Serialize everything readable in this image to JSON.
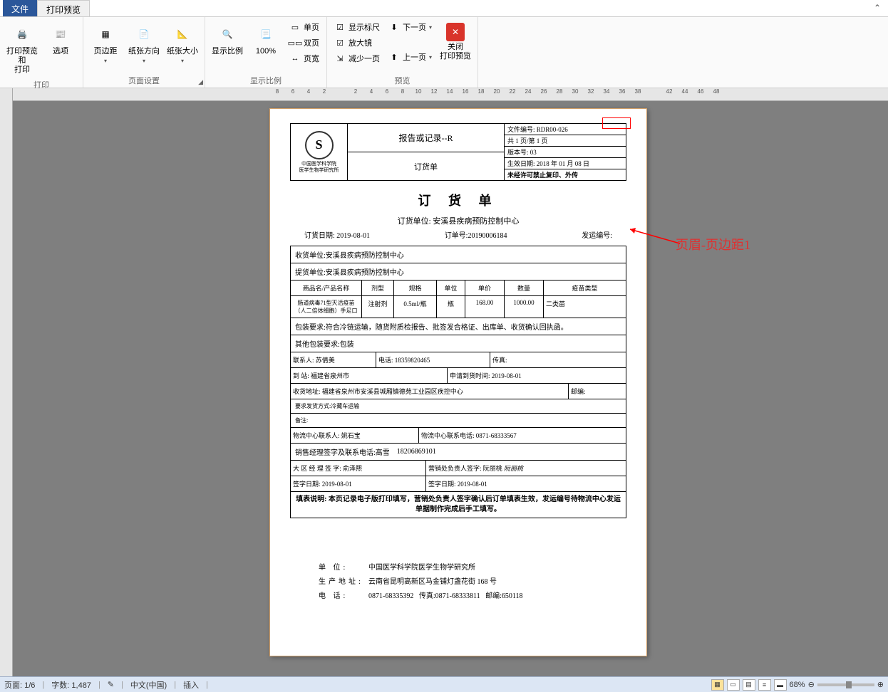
{
  "tabs": {
    "file": "文件",
    "preview": "打印预览"
  },
  "ribbon": {
    "print": {
      "preview_print": "打印预览和\n打印",
      "options": "选项",
      "group": "打印"
    },
    "page_setup": {
      "margins": "页边距",
      "orientation": "纸张方向",
      "size": "纸张大小",
      "group": "页面设置"
    },
    "zoom": {
      "show_ratio": "显示比例",
      "pct": "100%",
      "single": "单页",
      "double": "双页",
      "page_width": "页宽",
      "group": "显示比例"
    },
    "preview": {
      "ruler": "显示标尺",
      "magnifier": "放大镜",
      "shrink": "减少一页",
      "next": "下一页",
      "prev": "上一页",
      "close": "关闭\n打印预览",
      "group": "预览"
    }
  },
  "ruler_marks": [
    "8",
    "6",
    "4",
    "2",
    "",
    "2",
    "4",
    "6",
    "8",
    "10",
    "12",
    "14",
    "16",
    "18",
    "20",
    "22",
    "24",
    "26",
    "28",
    "30",
    "32",
    "34",
    "36",
    "38",
    "",
    "42",
    "44",
    "46",
    "48"
  ],
  "annotation": "页眉-页边距1",
  "doc": {
    "logo_org1": "中国医学科学院",
    "logo_org2": "医学生物学研究所",
    "report_title": "报告或记录--R",
    "sub_title": "订货单",
    "file_no_label": "文件编号:",
    "file_no": "RDR00-026",
    "pages": "共 1 页/第 1 页",
    "version": "版本号: 03",
    "effective": "生效日期: 2018 年 01 月 08 日",
    "restrict": "未经许可禁止复印、外传",
    "title": "订 货 单",
    "order_unit_label": "订货单位:",
    "order_unit": "安溪县疾病预防控制中心",
    "order_date_label": "订货日期:",
    "order_date": "2019-08-01",
    "order_no_label": "订单号:",
    "order_no": "20190006184",
    "ship_no_label": "发运编号:",
    "recv_unit_label": "收货单位:",
    "recv_unit": "安溪县疾病预防控制中心",
    "bill_unit_label": "提货单位:",
    "bill_unit": "安溪县疾病预防控制中心",
    "cols": {
      "name": "商品名/产品名称",
      "form": "剂型",
      "spec": "规格",
      "unit": "单位",
      "price": "单价",
      "qty": "数量",
      "type": "疫苗类型"
    },
    "row1": {
      "name": "肠道病毒71型灭活疫苗（人二倍体细胞）手足口",
      "form": "注射剂",
      "spec": "0.5ml/瓶",
      "unit": "瓶",
      "price": "168.00",
      "qty": "1000.00",
      "type": "二类苗"
    },
    "pack_req_label": "包装要求:",
    "pack_req": "符合冷链运输，随货附质检报告、批签发合格证、出库单、收货确认回执函。",
    "other_pack_label": "其他包装要求:",
    "other_pack": "包装",
    "contact_label": "联系人:",
    "contact": "苏倩美",
    "phone_label": "电话:",
    "phone": "18359820465",
    "fax_label": "传真:",
    "dest_label": "到   站:",
    "dest": "福建省泉州市",
    "apply_date_label": "申请到货时间:",
    "apply_date": "2019-08-01",
    "recv_addr_label": "收货地址:",
    "recv_addr": "福建省泉州市安溪县城厢镇德苑工业园区疾控中心",
    "post_label": "邮编:",
    "ship_method_label": "要求发货方式:",
    "ship_method": "冷藏车运输",
    "remark_label": "备注:",
    "logi_contact_label": "物流中心联系人:",
    "logi_contact": "姚石宝",
    "logi_phone_label": "物流中心联系电话:",
    "logi_phone": "0871-68333567",
    "sales_sign_label": "销售经理签字及联系电话:",
    "sales_sign": "高雪",
    "sales_phone": "18206869101",
    "region_sign_label": "大 区 经 理 签 字:",
    "region_sign": "俞泽熙",
    "office_sign_label": "营销处负责人签字:",
    "office_sign": "阮丽桃",
    "office_sign_script": "阮丽桃",
    "sign_date_label": "签字日期:",
    "sign_date1": "2019-08-01",
    "sign_date2": "2019-08-01",
    "note": "填表说明: 本页记录电子版打印填写，营销处负责人签字确认后订单填表生效，发运编号待物流中心发运单据制作完成后手工填写。",
    "footer_unit_label": "单    位:",
    "footer_unit": "中国医学科学院医学生物学研究所",
    "footer_addr_label": "生产地址:",
    "footer_addr": "云南省昆明高新区马金铺灯盏花街 168 号",
    "footer_tel_label": "电    话:",
    "footer_tel": "0871-68335392",
    "footer_fax_label": "传真:",
    "footer_fax": "0871-68333811",
    "footer_post_label": "邮编:",
    "footer_post": "650118"
  },
  "status": {
    "page_label": "页面:",
    "page": "1/6",
    "words_label": "字数:",
    "words": "1,487",
    "lang": "中文(中国)",
    "mode": "插入",
    "zoom": "68%"
  }
}
